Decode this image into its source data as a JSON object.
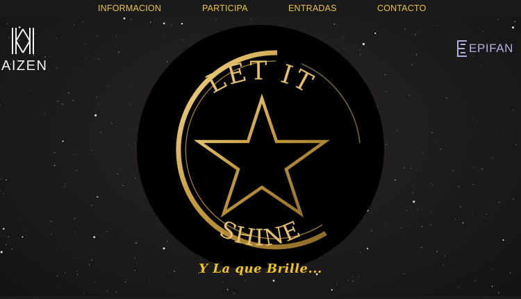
{
  "nav": {
    "items": [
      {
        "label": "INFORMACION"
      },
      {
        "label": "PARTICIPA"
      },
      {
        "label": "ENTRADAS"
      },
      {
        "label": "CONTACTO"
      }
    ]
  },
  "brands": {
    "left": {
      "name": "AIZEN",
      "icon": "kaizen-k-monogram-icon"
    },
    "right": {
      "name": "EPIFAN",
      "icon": "epifan-e-icon"
    }
  },
  "hero": {
    "logo_top_text": "LET IT",
    "logo_bottom_text": "SHINE",
    "logo_icon": "star-icon",
    "tagline": "Y La que Brille..."
  },
  "colors": {
    "nav_text": "#e8c248",
    "gold": "#c9a24a",
    "tagline": "#f0c420",
    "logo_bg": "#000000"
  }
}
